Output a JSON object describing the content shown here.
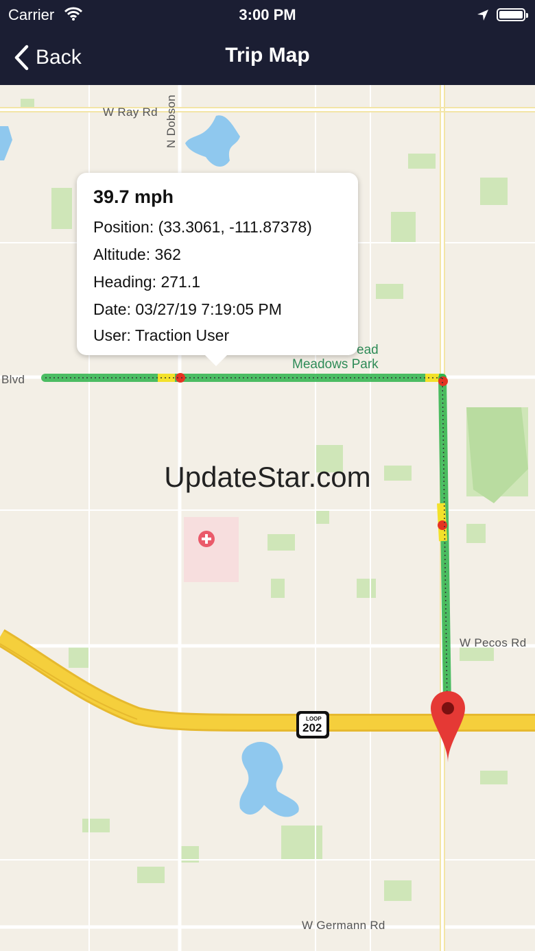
{
  "status_bar": {
    "carrier": "Carrier",
    "time": "3:00 PM"
  },
  "nav": {
    "back_label": "Back",
    "title": "Trip Map"
  },
  "map": {
    "labels": {
      "w_ray_rd": "W Ray Rd",
      "n_dobson": "N Dobson",
      "blvd": "Blvd",
      "park_top": "ead",
      "park": "Meadows Park",
      "w_pecos_rd": "W Pecos Rd",
      "w_germann_rd": "W Germann Rd",
      "loop_shield_top": "LOOP",
      "loop_shield_number": "202"
    },
    "watermark": "UpdateStar.com"
  },
  "callout": {
    "speed": "39.7 mph",
    "position": "Position: (33.3061, -111.87378)",
    "altitude": "Altitude: 362",
    "heading": "Heading: 271.1",
    "date": "Date: 03/27/19 7:19:05 PM",
    "user": "User: Traction User"
  },
  "colors": {
    "nav_bg": "#1b1e33",
    "route_green": "#2db34a",
    "route_yellow": "#f3e12a",
    "route_red": "#e53321",
    "pin_red": "#e53935",
    "freeway": "#f5cf3c"
  },
  "icons": [
    "wifi-icon",
    "location-arrow-icon",
    "battery-icon",
    "back-chevron-icon",
    "hospital-icon",
    "map-pin-icon"
  ]
}
